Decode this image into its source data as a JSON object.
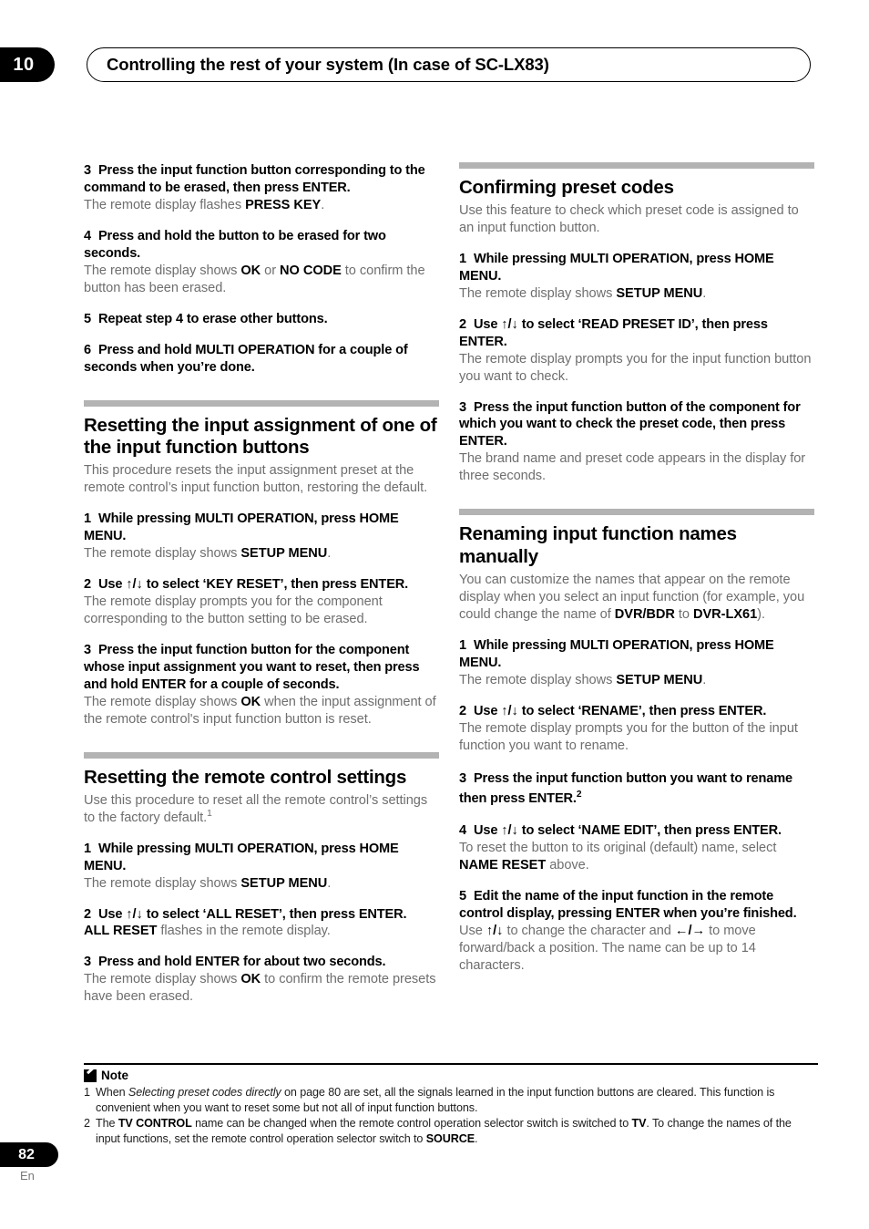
{
  "header": {
    "chapter_number": "10",
    "title": "Controlling the rest of your system (In case of SC-LX83)"
  },
  "left_column": {
    "steps_continued": [
      {
        "num": "3",
        "title_parts": [
          "Press the input function button corresponding to the command to be erased, then press ENTER."
        ],
        "body_pre": "The remote display flashes ",
        "body_bold": "PRESS KEY",
        "body_post": "."
      },
      {
        "num": "4",
        "title": "Press and hold the button to be erased for two seconds.",
        "body_pre": "The remote display shows ",
        "body_bold1": "OK",
        "body_mid": " or ",
        "body_bold2": "NO CODE",
        "body_post": " to confirm the button has been erased."
      },
      {
        "num": "5",
        "title": "Repeat step 4 to erase other buttons."
      },
      {
        "num": "6",
        "title": "Press and hold MULTI OPERATION for a couple of seconds when you’re done."
      }
    ],
    "section_reset_input_assignment": {
      "title": "Resetting the input assignment of one of the input function buttons",
      "intro": "This procedure resets the input assignment preset at the remote control’s input function button, restoring the default.",
      "step1": {
        "num": "1",
        "title": "While pressing MULTI OPERATION, press HOME MENU.",
        "body_pre": "The remote display shows ",
        "body_bold": "SETUP MENU",
        "body_post": "."
      },
      "step2": {
        "num": "2",
        "title_pre": "Use ",
        "arrows": "↑/↓",
        "title_post": " to select ‘KEY RESET’, then press ENTER.",
        "body": "The remote display prompts you for the component corresponding to the button setting to be erased."
      },
      "step3": {
        "num": "3",
        "title": "Press the input function button for the component whose input assignment you want to reset, then press and hold ENTER for a couple of seconds.",
        "body_pre": "The remote display shows ",
        "body_bold": "OK",
        "body_post": " when the input assignment of the remote control's input function button is reset."
      }
    },
    "section_reset_remote": {
      "title": "Resetting the remote control settings",
      "intro_pre": "Use this procedure to reset all the remote control’s settings to the factory default.",
      "intro_footnote": "1",
      "step1": {
        "num": "1",
        "title": "While pressing MULTI OPERATION, press HOME MENU.",
        "body_pre": "The remote display shows ",
        "body_bold": "SETUP MENU",
        "body_post": "."
      },
      "step2": {
        "num": "2",
        "title_pre": "Use ",
        "arrows": "↑/↓",
        "title_post": " to select ‘ALL RESET’, then press ENTER.",
        "body_bold": "ALL RESET",
        "body_post": " flashes in the remote display."
      },
      "step3": {
        "num": "3",
        "title": "Press and hold ENTER for about two seconds.",
        "body_pre": "The remote display shows ",
        "body_bold": "OK",
        "body_post": " to confirm the remote presets have been erased."
      }
    }
  },
  "right_column": {
    "section_confirming_preset_codes": {
      "title": "Confirming preset codes",
      "intro": "Use this feature to check which preset code is assigned to an input function button.",
      "step1": {
        "num": "1",
        "title": "While pressing MULTI OPERATION, press HOME MENU.",
        "body_pre": "The remote display shows ",
        "body_bold": "SETUP MENU",
        "body_post": "."
      },
      "step2": {
        "num": "2",
        "title_pre": "Use ",
        "arrows": "↑/↓",
        "title_post": " to select ‘READ PRESET ID’, then press ENTER.",
        "body": "The remote display prompts you for the input function button you want to check."
      },
      "step3": {
        "num": "3",
        "title": "Press the input function button of the component for which you want to check the preset code, then press ENTER.",
        "body": "The brand name and preset code appears in the display for three seconds."
      }
    },
    "section_renaming": {
      "title": "Renaming input function names manually",
      "intro_pre": "You can customize the names that appear on the remote display when you select an input function (for example, you could change the name of ",
      "intro_bold1": "DVR/BDR",
      "intro_mid": " to ",
      "intro_bold2": "DVR-LX61",
      "intro_post": ").",
      "step1": {
        "num": "1",
        "title": "While pressing MULTI OPERATION, press HOME MENU.",
        "body_pre": "The remote display shows ",
        "body_bold": "SETUP MENU",
        "body_post": "."
      },
      "step2": {
        "num": "2",
        "title_pre": "Use ",
        "arrows": "↑/↓",
        "title_post": " to select ‘RENAME’, then press ENTER.",
        "body": "The remote display prompts you for the button of the input function you want to rename."
      },
      "step3": {
        "num": "3",
        "title": "Press the input function button you want to rename then press ENTER.",
        "footnote": "2"
      },
      "step4": {
        "num": "4",
        "title_pre": "Use ",
        "arrows": "↑/↓",
        "title_post": " to select ‘NAME EDIT’, then press ENTER.",
        "body_pre": "To reset the button to its original (default) name, select ",
        "body_bold": "NAME RESET",
        "body_post": " above."
      },
      "step5": {
        "num": "5",
        "title": "Edit the name of the input function in the remote control display, pressing ENTER when you’re finished.",
        "body_pre": "Use ",
        "arrows_ud": "↑/↓",
        "body_mid": " to change the character and ",
        "arrows_lr": "←/→",
        "body_post": " to move forward/back a position. The name can be up to 14 characters."
      }
    }
  },
  "notes": {
    "label": "Note",
    "icon": "pencil-icon",
    "items": [
      {
        "num": "1",
        "pre": "When ",
        "italic": "Selecting preset codes directly",
        "post": " on page 80 are set, all the signals learned in the input function buttons are cleared. This function is convenient when you want to reset some but not all of input function buttons."
      },
      {
        "num": "2",
        "pre": "The ",
        "bold1": "TV CONTROL",
        "mid1": " name can be changed when the remote control operation selector switch is switched to ",
        "bold2": "TV",
        "mid2": ". To change the names of the input functions, set the remote control operation selector switch to ",
        "bold3": "SOURCE",
        "post": "."
      }
    ]
  },
  "footer": {
    "page_number": "82",
    "language": "En"
  },
  "colors": {
    "accent_black": "#000000",
    "rule_gray": "#b3b3b3",
    "body_gray": "#6e6e6e"
  }
}
